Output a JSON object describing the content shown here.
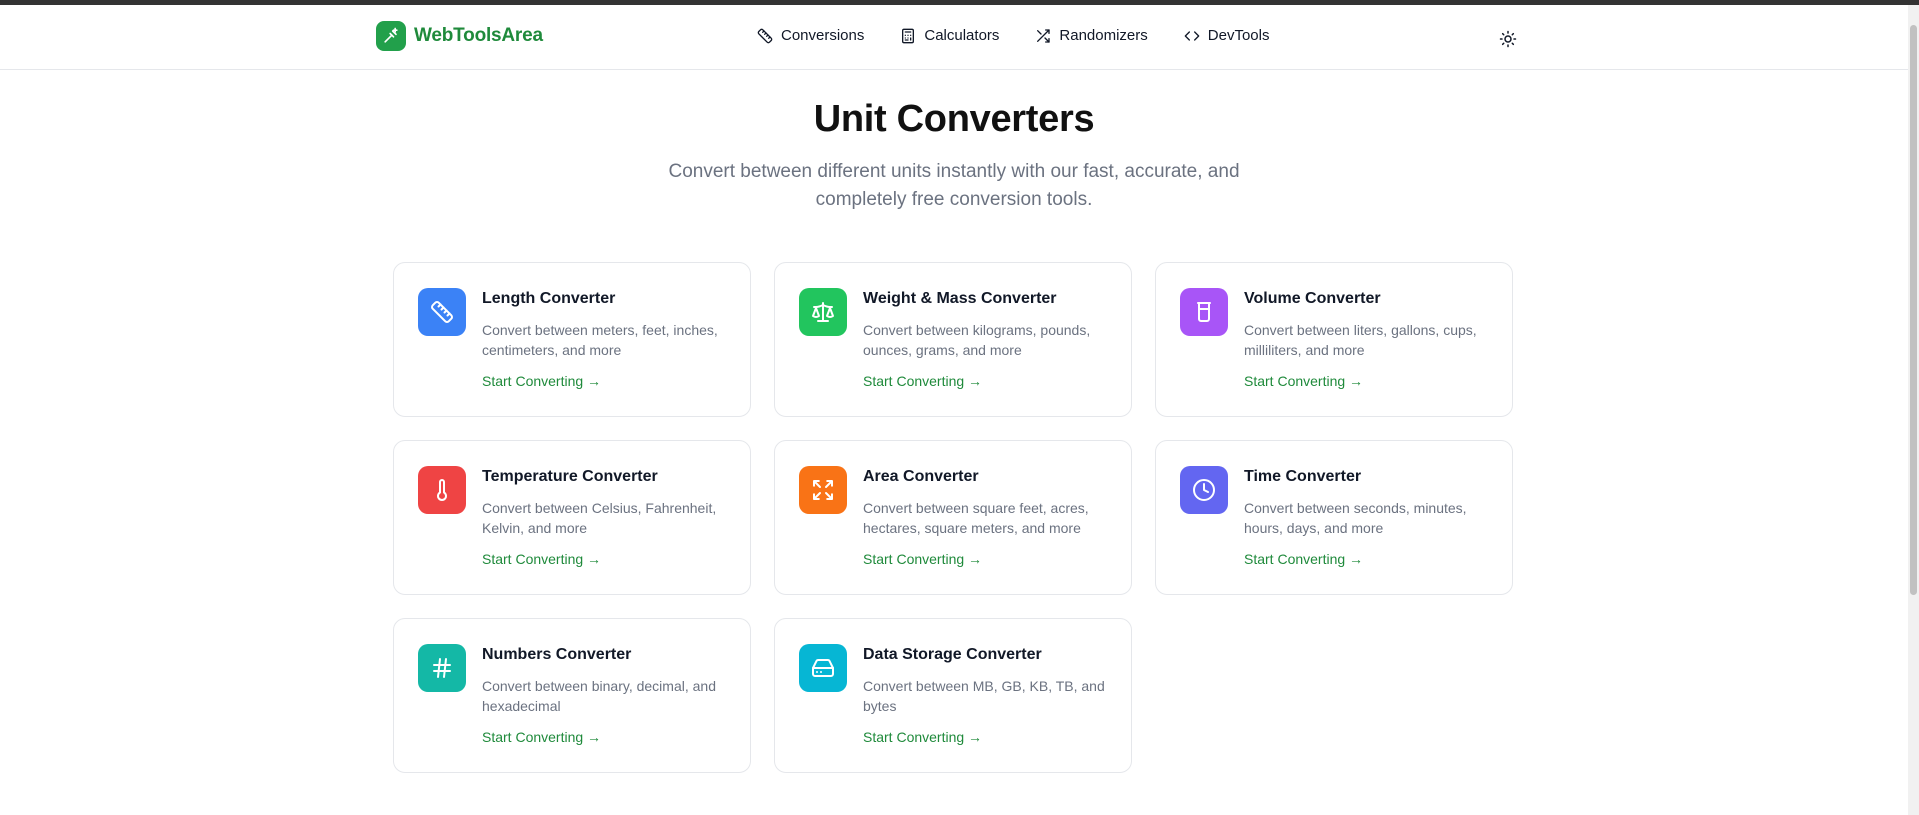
{
  "brand": {
    "name": "WebToolsArea",
    "color": "#1f8a3b"
  },
  "nav": [
    {
      "label": "Conversions",
      "icon": "ruler-icon"
    },
    {
      "label": "Calculators",
      "icon": "calculator-icon"
    },
    {
      "label": "Randomizers",
      "icon": "shuffle-icon"
    },
    {
      "label": "DevTools",
      "icon": "code-icon"
    }
  ],
  "theme_toggle_icon": "sun-icon",
  "page": {
    "title": "Unit Converters",
    "subtitle": "Convert between different units instantly with our fast, accurate, and completely free conversion tools."
  },
  "cards": [
    {
      "title": "Length Converter",
      "description": "Convert between meters, feet, inches, centimeters, and more",
      "link": "Start Converting →",
      "icon": "ruler-icon",
      "color": "#3b82f6"
    },
    {
      "title": "Weight & Mass Converter",
      "description": "Convert between kilograms, pounds, ounces, grams, and more",
      "link": "Start Converting →",
      "icon": "scale-icon",
      "color": "#22c55e"
    },
    {
      "title": "Volume Converter",
      "description": "Convert between liters, gallons, cups, milliliters, and more",
      "link": "Start Converting →",
      "icon": "beaker-icon",
      "color": "#a855f7"
    },
    {
      "title": "Temperature Converter",
      "description": "Convert between Celsius, Fahrenheit, Kelvin, and more",
      "link": "Start Converting →",
      "icon": "thermometer-icon",
      "color": "#ef4444"
    },
    {
      "title": "Area Converter",
      "description": "Convert between square feet, acres, hectares, square meters, and more",
      "link": "Start Converting →",
      "icon": "expand-icon",
      "color": "#f97316"
    },
    {
      "title": "Time Converter",
      "description": "Convert between seconds, minutes, hours, days, and more",
      "link": "Start Converting →",
      "icon": "clock-icon",
      "color": "#6366f1"
    },
    {
      "title": "Numbers Converter",
      "description": "Convert between binary, decimal, and hexadecimal",
      "link": "Start Converting →",
      "icon": "hash-icon",
      "color": "#14b8a6"
    },
    {
      "title": "Data Storage Converter",
      "description": "Convert between MB, GB, KB, TB, and bytes",
      "link": "Start Converting →",
      "icon": "hard-drive-icon",
      "color": "#06b6d4"
    }
  ]
}
